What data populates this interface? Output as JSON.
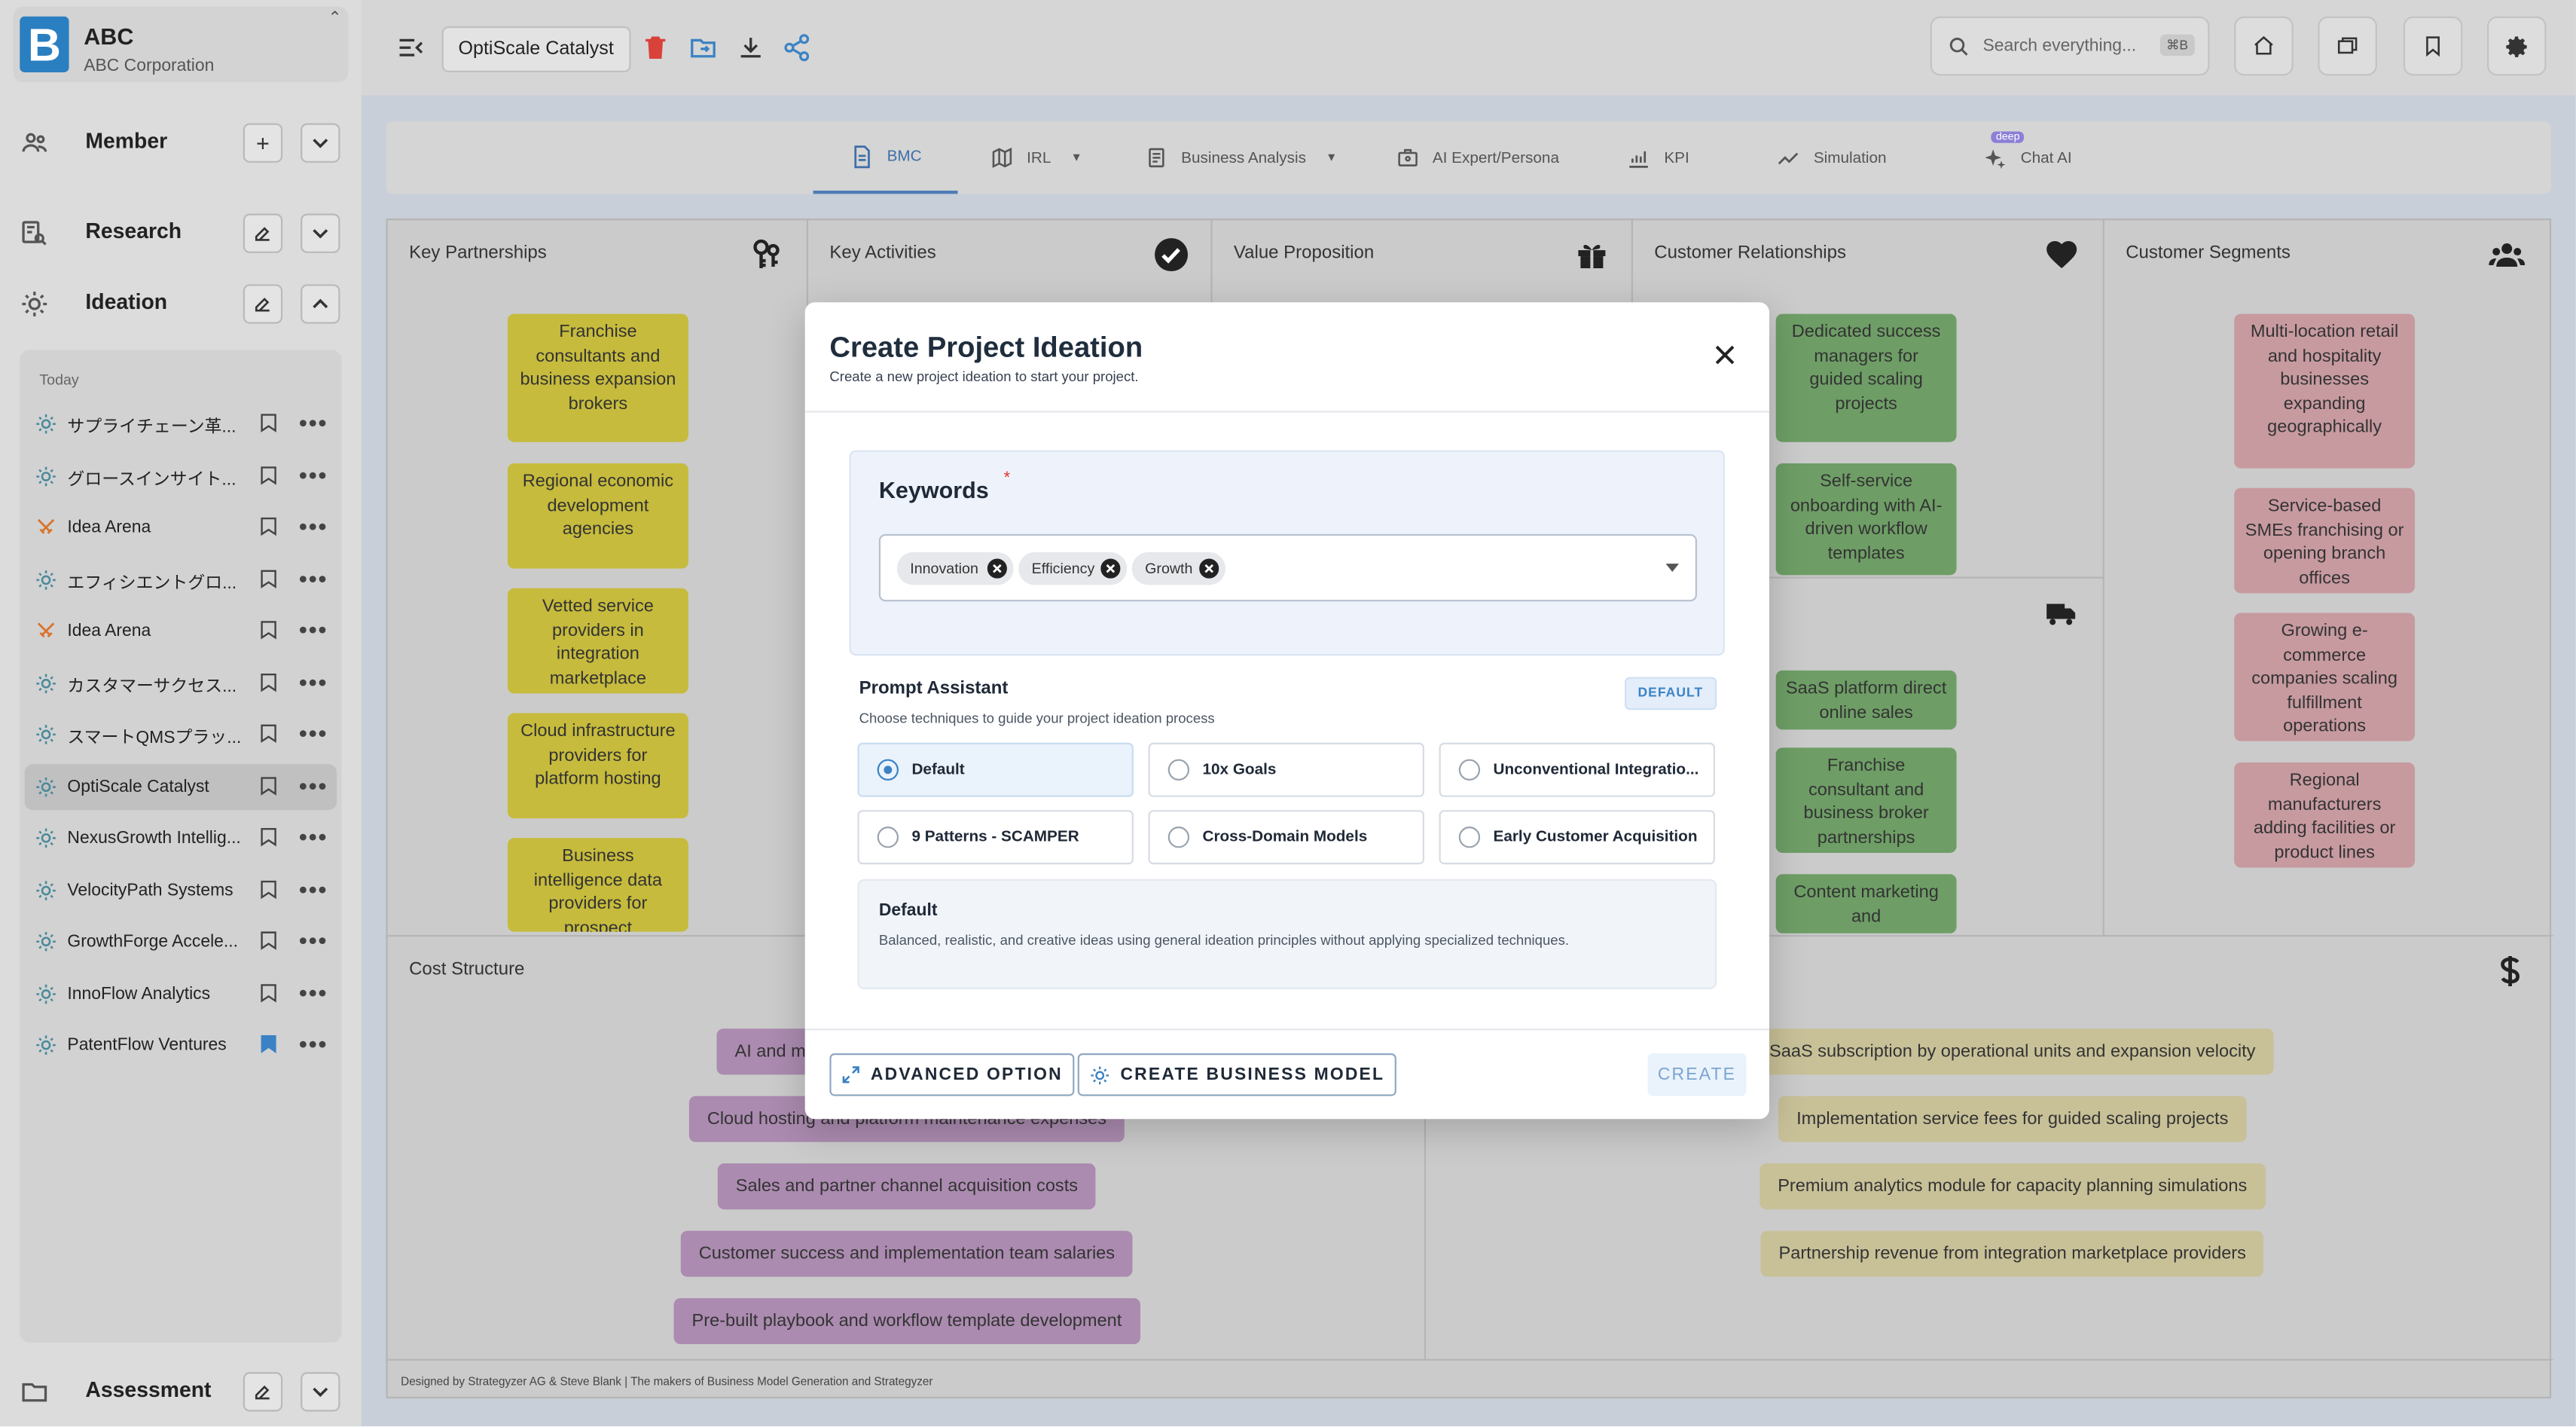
{
  "brand": {
    "name": "ABC",
    "subtitle": "ABC Corporation",
    "logo_letter": "B"
  },
  "sidebar": {
    "member_label": "Member",
    "research_label": "Research",
    "ideation_label": "Ideation",
    "assessment_label": "Assessment",
    "group_label": "Today",
    "items": [
      {
        "label": "サプライチェーン革...",
        "icon": "bulb-icon",
        "bookmarked": false
      },
      {
        "label": "グロースインサイト...",
        "icon": "bulb-icon",
        "bookmarked": false
      },
      {
        "label": "Idea Arena",
        "icon": "swords-icon",
        "bookmarked": false
      },
      {
        "label": "エフィシエントグロ...",
        "icon": "bulb-icon",
        "bookmarked": false
      },
      {
        "label": "Idea Arena",
        "icon": "swords-icon",
        "bookmarked": false
      },
      {
        "label": "カスタマーサクセス...",
        "icon": "bulb-icon",
        "bookmarked": false
      },
      {
        "label": "スマートQMSプラッ...",
        "icon": "bulb-icon",
        "bookmarked": false
      },
      {
        "label": "OptiScale Catalyst",
        "icon": "bulb-icon",
        "bookmarked": false,
        "active": true
      },
      {
        "label": "NexusGrowth Intellig...",
        "icon": "bulb-icon",
        "bookmarked": false
      },
      {
        "label": "VelocityPath Systems",
        "icon": "bulb-icon",
        "bookmarked": false
      },
      {
        "label": "GrowthForge Accele...",
        "icon": "bulb-icon",
        "bookmarked": false
      },
      {
        "label": "InnoFlow Analytics",
        "icon": "bulb-icon",
        "bookmarked": false
      },
      {
        "label": "PatentFlow Ventures",
        "icon": "bulb-icon",
        "bookmarked": true
      }
    ]
  },
  "topbar": {
    "project_name": "OptiScale Catalyst",
    "search_placeholder": "Search everything...",
    "search_shortcut": "⌘B"
  },
  "tabs": [
    {
      "label": "BMC",
      "active": true
    },
    {
      "label": "IRL",
      "dropdown": true
    },
    {
      "label": "Business Analysis",
      "dropdown": true
    },
    {
      "label": "AI Expert/Persona"
    },
    {
      "label": "KPI"
    },
    {
      "label": "Simulation"
    },
    {
      "label": "Chat AI",
      "badge": "deep"
    }
  ],
  "bmc": {
    "key_partnerships": {
      "title": "Key Partnerships",
      "notes": [
        "Franchise consultants and business expansion brokers",
        "Regional economic development agencies",
        "Vetted service providers in integration marketplace",
        "Cloud infrastructure providers for platform hosting",
        "Business intelligence data providers for prospect"
      ]
    },
    "key_activities": {
      "title": "Key Activities"
    },
    "value_proposition": {
      "title": "Value Proposition"
    },
    "customer_relationships": {
      "title": "Customer Relationships",
      "notes": [
        "Dedicated success managers for guided scaling projects",
        "Self-service onboarding with AI-driven workflow templates"
      ]
    },
    "channels": {
      "notes": [
        "SaaS platform direct online sales",
        "Franchise consultant and business broker partnerships",
        "Content marketing and"
      ]
    },
    "customer_segments": {
      "title": "Customer Segments",
      "notes": [
        "Multi-location retail and hospitality businesses expanding geographically",
        "Service-based SMEs franchising or opening branch offices",
        "Growing e-commerce companies scaling fulfillment operations",
        "Regional manufacturers adding facilities or product lines"
      ]
    },
    "cost_structure": {
      "title": "Cost Structure",
      "items": [
        "AI and machine learning development costs",
        "Cloud hosting and platform maintenance expenses",
        "Sales and partner channel acquisition costs",
        "Customer success and implementation team salaries",
        "Pre-built playbook and workflow template development"
      ]
    },
    "revenue_streams": {
      "items": [
        "SaaS subscription by operational units and expansion velocity",
        "Implementation service fees for guided scaling projects",
        "Premium analytics module for capacity planning simulations",
        "Partnership revenue from integration marketplace providers"
      ]
    },
    "footer": "Designed by Strategyzer AG & Steve Blank | The makers of Business Model Generation and Strategyzer"
  },
  "modal": {
    "title": "Create Project Ideation",
    "subtitle": "Create a new project ideation to start your project.",
    "keywords_label": "Keywords",
    "required_mark": "*",
    "keywords": [
      "Innovation",
      "Efficiency",
      "Growth"
    ],
    "prompt_assistant": {
      "title": "Prompt Assistant",
      "subtitle": "Choose techniques to guide your project ideation process",
      "badge": "DEFAULT",
      "options": [
        {
          "label": "Default",
          "selected": true
        },
        {
          "label": "10x Goals",
          "selected": false
        },
        {
          "label": "Unconventional Integratio...",
          "selected": false
        },
        {
          "label": "9 Patterns - SCAMPER",
          "selected": false
        },
        {
          "label": "Cross-Domain Models",
          "selected": false
        },
        {
          "label": "Early Customer Acquisition",
          "selected": false
        }
      ],
      "description_title": "Default",
      "description_text": "Balanced, realistic, and creative ideas using general ideation principles without applying specialized techniques."
    },
    "advanced_option_label": "ADVANCED OPTION",
    "create_business_model_label": "CREATE BUSINESS MODEL",
    "create_label": "CREATE"
  },
  "colors": {
    "accent": "#3b82c4",
    "note_yellow": "#e8db4a",
    "note_green": "#86c17c",
    "note_pink": "#e9b4bb",
    "pill_purple": "#c9a3cf",
    "pill_khaki": "#e9e2b3",
    "delete_red": "#e53935"
  }
}
